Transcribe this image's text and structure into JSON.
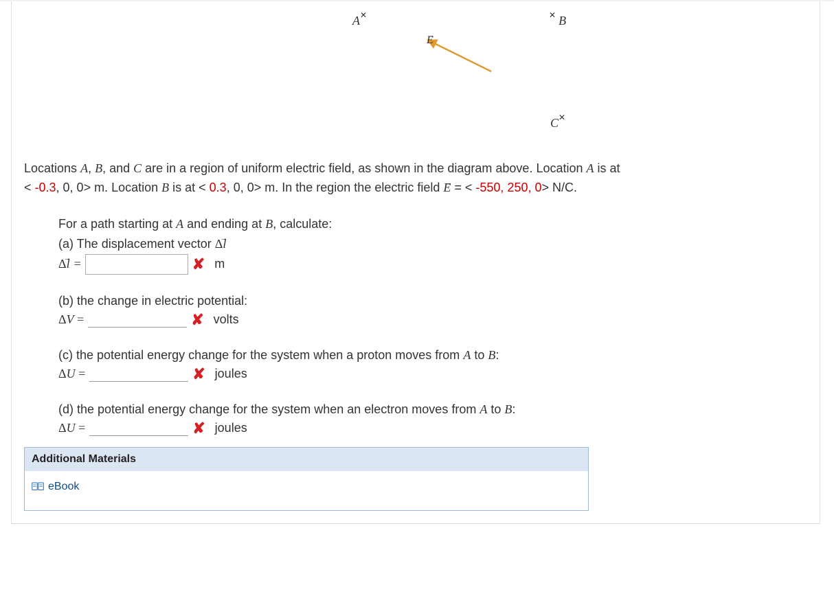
{
  "diagram": {
    "label_A": "A",
    "label_B": "B",
    "label_C": "C",
    "label_E": "E"
  },
  "intro": {
    "text1a": "Locations ",
    "A": "A",
    "text1b": ", ",
    "B": "B",
    "text1c": ", and ",
    "C": "C",
    "text1d": " are in a region of uniform electric field, as shown in the diagram above. Location ",
    "A2": "A",
    "text1e": " is at",
    "locA_open": "< ",
    "locA_val": "-0.3",
    "locA_rest": ", 0, 0> m. Location ",
    "B2": "B",
    "text2a": " is at < ",
    "locB_val": "0.3",
    "locB_rest": ", 0, 0> m. In the region the electric field ",
    "E_equals": " = < ",
    "Efield": "-550, 250, 0",
    "E_close": "> N/C."
  },
  "sub": {
    "startline_a": "For a path starting at ",
    "startline_A": "A",
    "startline_b": " and ending at ",
    "startline_B": "B",
    "startline_c": ", calculate:",
    "part_a_label": "(a) The displacement vector ",
    "delta_l_var_delta": "Δ",
    "delta_l_var_l": "l",
    "eq": "=",
    "unit_m": "m",
    "part_b_text": "(b) the change in electric potential:",
    "delta_V_label": "ΔV =",
    "unit_volts": "volts",
    "part_c_text": "(c) the potential energy change for the system when a proton moves from ",
    "part_c_A": "A",
    "part_c_to": " to ",
    "part_c_B": "B",
    "colon": ":",
    "delta_U_label": "ΔU =",
    "unit_joules": "joules",
    "part_d_text": "(d) the potential energy change for the system when an electron moves from ",
    "part_d_A": "A",
    "part_d_to": " to ",
    "part_d_B": "B"
  },
  "materials": {
    "header": "Additional Materials",
    "ebook": "eBook"
  },
  "wrong_mark": "✘"
}
